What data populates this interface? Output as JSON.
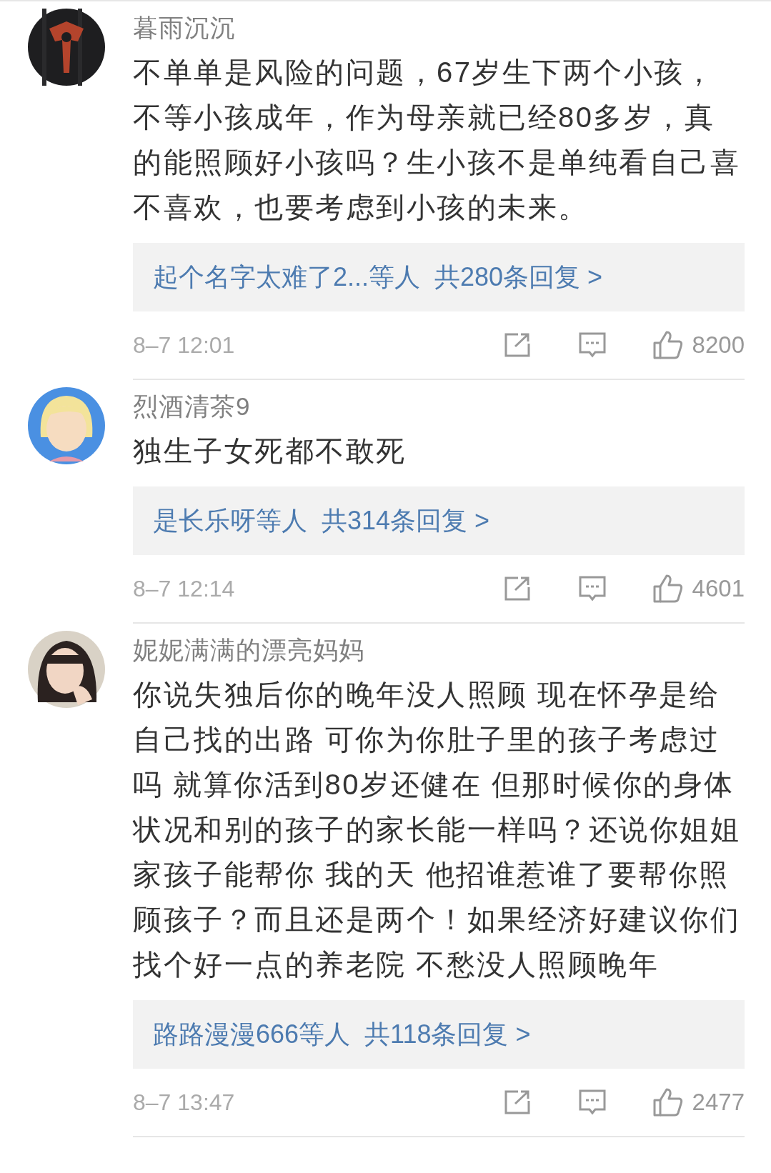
{
  "comments": [
    {
      "username": "暮雨沉沉",
      "text": "不单单是风险的问题，67岁生下两个小孩，不等小孩成年，作为母亲就已经80多岁，真的能照顾好小孩吗？生小孩不是单纯看自己喜不喜欢，也要考虑到小孩的未来。",
      "replies": {
        "users": "起个名字太难了2...等人",
        "total": "共280条回复 >"
      },
      "time": "8–7 12:01",
      "likes": "8200"
    },
    {
      "username": "烈酒清茶9",
      "text": "独生子女死都不敢死",
      "replies": {
        "users": "是长乐呀等人",
        "total": "共314条回复 >"
      },
      "time": "8–7 12:14",
      "likes": "4601"
    },
    {
      "username": "妮妮满满的漂亮妈妈",
      "text": "你说失独后你的晚年没人照顾 现在怀孕是给自己找的出路 可你为你肚子里的孩子考虑过吗 就算你活到80岁还健在 但那时候你的身体状况和别的孩子的家长能一样吗？还说你姐姐家孩子能帮你 我的天 他招谁惹谁了要帮你照顾孩子？而且还是两个！如果经济好建议你们找个好一点的养老院 不愁没人照顾晚年",
      "replies": {
        "users": "路路漫漫666等人",
        "total": "共118条回复 >"
      },
      "time": "8–7 13:47",
      "likes": "2477"
    }
  ]
}
